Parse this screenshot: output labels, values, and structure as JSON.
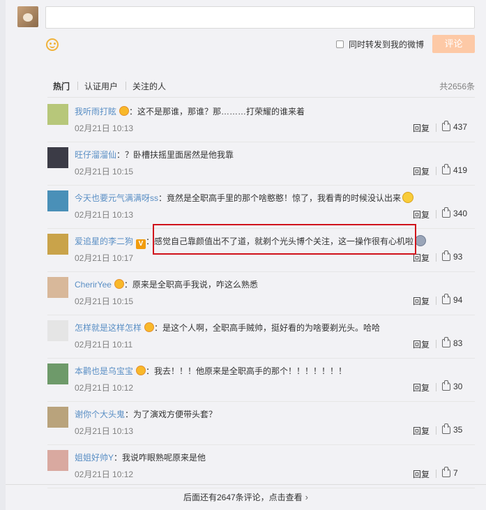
{
  "composer": {
    "input_placeholder": "",
    "forward_label": "同时转发到我的微博",
    "submit_label": "评论",
    "submit_color": "#fdc9a6"
  },
  "tabs": {
    "items": [
      "热门",
      "认证用户",
      "关注的人"
    ],
    "active": "热门",
    "total": "共2656条"
  },
  "comments": [
    {
      "user": "我听雨打眩",
      "badge": "fan",
      "text": "：这不是那谁，那谁？那………打荣耀的谁来着",
      "emoji": "",
      "time": "02月21日 10:13",
      "reply": "回复",
      "likes": "437",
      "avatar_color": "#b7c77a"
    },
    {
      "user": "旺仔溜溜仙",
      "badge": "",
      "text": "：？卧槽扶摇里面居然是他我靠",
      "emoji": "",
      "time": "02月21日 10:15",
      "reply": "回复",
      "likes": "419",
      "avatar_color": "#3b3b46"
    },
    {
      "user": "今天也要元气满满呀ss",
      "badge": "",
      "text": "：竟然是全职高手里的那个啥憨憨！惊了，我看青的时候没认出来",
      "emoji": "laugh",
      "time": "02月21日 10:13",
      "reply": "回复",
      "likes": "340",
      "avatar_color": "#4a90b8"
    },
    {
      "user": "爱追星的李二狗",
      "badge": "vip",
      "text": "：感觉自己靠颜值出不了道，就剃个光头博个关注，这一操作很有心机啦",
      "emoji": "grey",
      "time": "02月21日 10:17",
      "reply": "回复",
      "likes": "93",
      "avatar_color": "#c9a34a"
    },
    {
      "user": "CherirYee",
      "badge": "fan",
      "text": "：原来是全职高手我说，咋这么熟悉",
      "emoji": "",
      "time": "02月21日 10:15",
      "reply": "回复",
      "likes": "94",
      "avatar_color": "#d8b89a"
    },
    {
      "user": "怎样就是这样怎样",
      "badge": "fan",
      "text": "：是这个人啊，全职高手贼帅，挺好看的为啥要剃光头。哈哈",
      "emoji": "",
      "time": "02月21日 10:11",
      "reply": "回复",
      "likes": "83",
      "avatar_color": "#e5e5e5"
    },
    {
      "user": "本鹳也是乌宝宝",
      "badge": "fan",
      "text": "：我去！！！他原来是全职高手的那个！！！！！！！",
      "emoji": "",
      "time": "02月21日 10:12",
      "reply": "回复",
      "likes": "30",
      "avatar_color": "#6e9a6a"
    },
    {
      "user": "谢你个大头鬼",
      "badge": "",
      "text": "：为了演戏方便带头套？",
      "emoji": "",
      "time": "02月21日 10:13",
      "reply": "回复",
      "likes": "35",
      "avatar_color": "#b9a37c"
    },
    {
      "user": "姐姐好帅Y",
      "badge": "",
      "text": "：我说咋眼熟呢原来是他",
      "emoji": "",
      "time": "02月21日 10:12",
      "reply": "回复",
      "likes": "7",
      "avatar_color": "#d9a9a0"
    }
  ],
  "more_link": "后面还有2647条评论，点击查看",
  "highlight_color": "#d0121b"
}
